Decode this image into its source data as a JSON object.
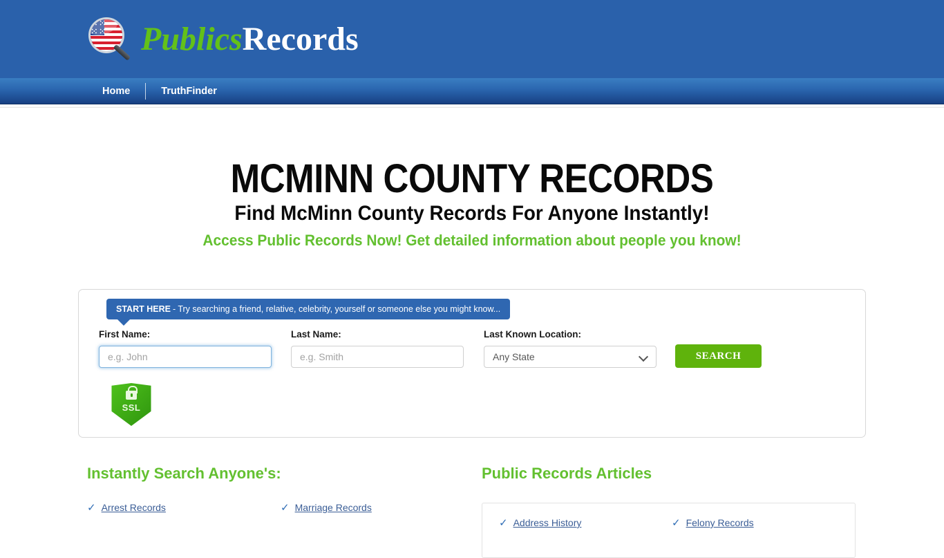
{
  "header": {
    "logo_primary": "Publics",
    "logo_secondary": "Records",
    "logo_icon": "magnifying-glass-us-flag-icon",
    "brand_blue": "#2a61ab",
    "brand_green": "#63c119"
  },
  "nav": {
    "items": [
      {
        "label": "Home"
      },
      {
        "label": "TruthFinder"
      }
    ]
  },
  "hero": {
    "title": "MCMINN COUNTY RECORDS",
    "subtitle": "Find McMinn County Records For Anyone Instantly!",
    "tagline": "Access Public Records Now! Get detailed information about people you know!",
    "tagline_color": "#63c030"
  },
  "search": {
    "callout_bold": "START HERE",
    "callout_text": "- Try searching a friend, relative, celebrity, yourself or someone else you might know...",
    "first_name_label": "First Name:",
    "first_name_placeholder": "e.g. John",
    "first_name_value": "",
    "last_name_label": "Last Name:",
    "last_name_placeholder": "e.g. Smith",
    "last_name_value": "",
    "location_label": "Last Known Location:",
    "location_selected": "Any State",
    "location_options": [
      "Any State"
    ],
    "search_button": "SEARCH",
    "search_button_color": "#5fb30c",
    "ssl_badge_text": "SSL",
    "ssl_badge_icon": "padlock-shield-icon"
  },
  "instant_search": {
    "heading": "Instantly Search Anyone's:",
    "links": [
      {
        "label": "Arrest Records"
      },
      {
        "label": "Marriage Records"
      }
    ]
  },
  "articles": {
    "heading": "Public Records Articles",
    "links": [
      {
        "label": "Address History"
      },
      {
        "label": "Felony Records"
      }
    ]
  },
  "icons": {
    "check": "✓",
    "chevron_down": "chevron-down-icon"
  }
}
